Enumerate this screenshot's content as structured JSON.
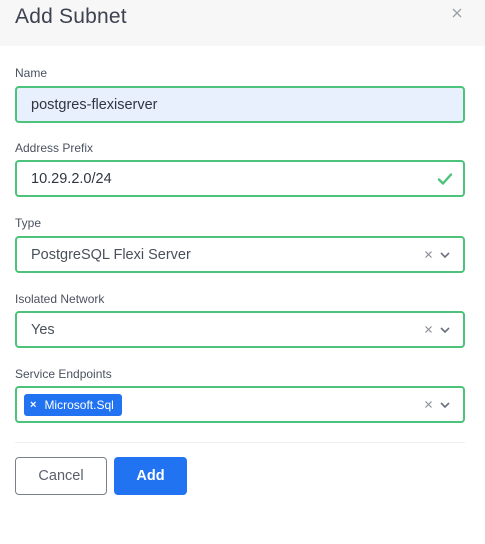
{
  "modal": {
    "title": "Add Subnet",
    "close_icon": "close-icon"
  },
  "fields": {
    "name": {
      "label": "Name",
      "value": "postgres-flexiserver"
    },
    "address_prefix": {
      "label": "Address Prefix",
      "value": "10.29.2.0/24",
      "valid_icon": "check-icon"
    },
    "type": {
      "label": "Type",
      "value": "PostgreSQL Flexi Server"
    },
    "isolated_network": {
      "label": "Isolated Network",
      "value": "Yes"
    },
    "service_endpoints": {
      "label": "Service Endpoints",
      "tags": [
        "Microsoft.Sql"
      ]
    }
  },
  "footer": {
    "cancel_label": "Cancel",
    "add_label": "Add"
  },
  "colors": {
    "valid_border": "#4cc27b",
    "primary": "#2273f2",
    "name_fill": "#e9f0fd"
  }
}
